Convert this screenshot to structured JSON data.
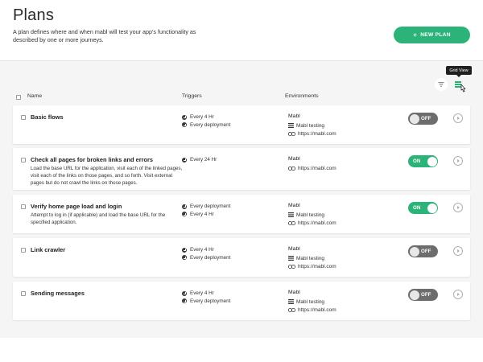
{
  "header": {
    "title": "Plans",
    "description": "A plan defines where and when mabl will test your app's functionality as described by one or more journeys.",
    "new_plan_label": "NEW PLAN",
    "new_plan_icon": "plus-icon"
  },
  "toolbar": {
    "tooltip": "Grid View",
    "filter_icon": "filter-icon",
    "grid_icon": "grid-view-icon"
  },
  "table": {
    "columns": [
      "Name",
      "Triggers",
      "Environments"
    ]
  },
  "plans": [
    {
      "name": "Basic flows",
      "description": "",
      "triggers": [
        "Every 4 Hr",
        "Every deployment"
      ],
      "environment": "Mabl",
      "application": "Mabl testing",
      "url": "https://mabl.com",
      "status": "OFF",
      "enabled": false
    },
    {
      "name": "Check all pages for broken links and errors",
      "description": "Load the base URL for the application, visit each of the linked pages, visit each of the links on those pages, and so forth. Visit external pages but do not crawl the links on those pages.",
      "triggers": [
        "Every 24 Hr"
      ],
      "environment": "Mabl",
      "application": "",
      "url": "https://mabl.com",
      "status": "ON",
      "enabled": true
    },
    {
      "name": "Verify home page load and login",
      "description": "Attempt to log in (if applicable) and load the base URL for the specified application.",
      "triggers": [
        "Every deployment",
        "Every 4 Hr"
      ],
      "environment": "Mabl",
      "application": "Mabl testing",
      "url": "https://mabl.com",
      "status": "ON",
      "enabled": true
    },
    {
      "name": "Link crawler",
      "description": "",
      "triggers": [
        "Every 4 Hr",
        "Every deployment"
      ],
      "environment": "Mabl",
      "application": "Mabl testing",
      "url": "https://mabl.com",
      "status": "OFF",
      "enabled": false
    },
    {
      "name": "Sending messages",
      "description": "",
      "triggers": [
        "Every 4 Hr",
        "Every deployment"
      ],
      "environment": "Mabl",
      "application": "Mabl testing",
      "url": "https://mabl.com",
      "status": "OFF",
      "enabled": false
    }
  ],
  "colors": {
    "accent": "#2bb37a",
    "toggle_off": "#6d6d6d",
    "background": "#f5f5f5"
  }
}
